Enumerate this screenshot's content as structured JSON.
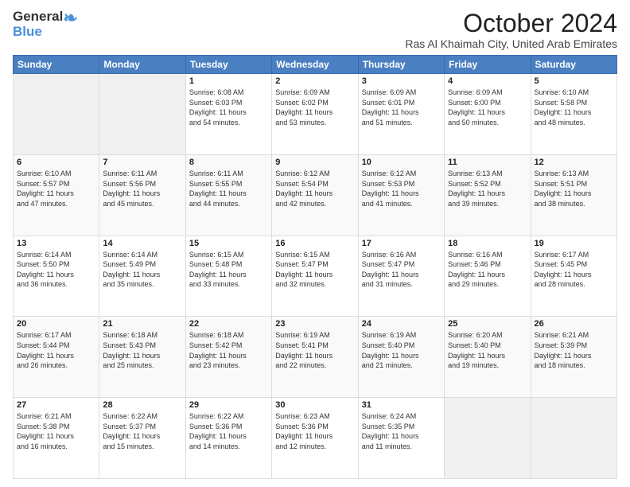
{
  "logo": {
    "line1": "General",
    "line2": "Blue"
  },
  "title": "October 2024",
  "location": "Ras Al Khaimah City, United Arab Emirates",
  "days_header": [
    "Sunday",
    "Monday",
    "Tuesday",
    "Wednesday",
    "Thursday",
    "Friday",
    "Saturday"
  ],
  "weeks": [
    [
      {
        "day": "",
        "info": ""
      },
      {
        "day": "",
        "info": ""
      },
      {
        "day": "1",
        "info": "Sunrise: 6:08 AM\nSunset: 6:03 PM\nDaylight: 11 hours\nand 54 minutes."
      },
      {
        "day": "2",
        "info": "Sunrise: 6:09 AM\nSunset: 6:02 PM\nDaylight: 11 hours\nand 53 minutes."
      },
      {
        "day": "3",
        "info": "Sunrise: 6:09 AM\nSunset: 6:01 PM\nDaylight: 11 hours\nand 51 minutes."
      },
      {
        "day": "4",
        "info": "Sunrise: 6:09 AM\nSunset: 6:00 PM\nDaylight: 11 hours\nand 50 minutes."
      },
      {
        "day": "5",
        "info": "Sunrise: 6:10 AM\nSunset: 5:58 PM\nDaylight: 11 hours\nand 48 minutes."
      }
    ],
    [
      {
        "day": "6",
        "info": "Sunrise: 6:10 AM\nSunset: 5:57 PM\nDaylight: 11 hours\nand 47 minutes."
      },
      {
        "day": "7",
        "info": "Sunrise: 6:11 AM\nSunset: 5:56 PM\nDaylight: 11 hours\nand 45 minutes."
      },
      {
        "day": "8",
        "info": "Sunrise: 6:11 AM\nSunset: 5:55 PM\nDaylight: 11 hours\nand 44 minutes."
      },
      {
        "day": "9",
        "info": "Sunrise: 6:12 AM\nSunset: 5:54 PM\nDaylight: 11 hours\nand 42 minutes."
      },
      {
        "day": "10",
        "info": "Sunrise: 6:12 AM\nSunset: 5:53 PM\nDaylight: 11 hours\nand 41 minutes."
      },
      {
        "day": "11",
        "info": "Sunrise: 6:13 AM\nSunset: 5:52 PM\nDaylight: 11 hours\nand 39 minutes."
      },
      {
        "day": "12",
        "info": "Sunrise: 6:13 AM\nSunset: 5:51 PM\nDaylight: 11 hours\nand 38 minutes."
      }
    ],
    [
      {
        "day": "13",
        "info": "Sunrise: 6:14 AM\nSunset: 5:50 PM\nDaylight: 11 hours\nand 36 minutes."
      },
      {
        "day": "14",
        "info": "Sunrise: 6:14 AM\nSunset: 5:49 PM\nDaylight: 11 hours\nand 35 minutes."
      },
      {
        "day": "15",
        "info": "Sunrise: 6:15 AM\nSunset: 5:48 PM\nDaylight: 11 hours\nand 33 minutes."
      },
      {
        "day": "16",
        "info": "Sunrise: 6:15 AM\nSunset: 5:47 PM\nDaylight: 11 hours\nand 32 minutes."
      },
      {
        "day": "17",
        "info": "Sunrise: 6:16 AM\nSunset: 5:47 PM\nDaylight: 11 hours\nand 31 minutes."
      },
      {
        "day": "18",
        "info": "Sunrise: 6:16 AM\nSunset: 5:46 PM\nDaylight: 11 hours\nand 29 minutes."
      },
      {
        "day": "19",
        "info": "Sunrise: 6:17 AM\nSunset: 5:45 PM\nDaylight: 11 hours\nand 28 minutes."
      }
    ],
    [
      {
        "day": "20",
        "info": "Sunrise: 6:17 AM\nSunset: 5:44 PM\nDaylight: 11 hours\nand 26 minutes."
      },
      {
        "day": "21",
        "info": "Sunrise: 6:18 AM\nSunset: 5:43 PM\nDaylight: 11 hours\nand 25 minutes."
      },
      {
        "day": "22",
        "info": "Sunrise: 6:18 AM\nSunset: 5:42 PM\nDaylight: 11 hours\nand 23 minutes."
      },
      {
        "day": "23",
        "info": "Sunrise: 6:19 AM\nSunset: 5:41 PM\nDaylight: 11 hours\nand 22 minutes."
      },
      {
        "day": "24",
        "info": "Sunrise: 6:19 AM\nSunset: 5:40 PM\nDaylight: 11 hours\nand 21 minutes."
      },
      {
        "day": "25",
        "info": "Sunrise: 6:20 AM\nSunset: 5:40 PM\nDaylight: 11 hours\nand 19 minutes."
      },
      {
        "day": "26",
        "info": "Sunrise: 6:21 AM\nSunset: 5:39 PM\nDaylight: 11 hours\nand 18 minutes."
      }
    ],
    [
      {
        "day": "27",
        "info": "Sunrise: 6:21 AM\nSunset: 5:38 PM\nDaylight: 11 hours\nand 16 minutes."
      },
      {
        "day": "28",
        "info": "Sunrise: 6:22 AM\nSunset: 5:37 PM\nDaylight: 11 hours\nand 15 minutes."
      },
      {
        "day": "29",
        "info": "Sunrise: 6:22 AM\nSunset: 5:36 PM\nDaylight: 11 hours\nand 14 minutes."
      },
      {
        "day": "30",
        "info": "Sunrise: 6:23 AM\nSunset: 5:36 PM\nDaylight: 11 hours\nand 12 minutes."
      },
      {
        "day": "31",
        "info": "Sunrise: 6:24 AM\nSunset: 5:35 PM\nDaylight: 11 hours\nand 11 minutes."
      },
      {
        "day": "",
        "info": ""
      },
      {
        "day": "",
        "info": ""
      }
    ]
  ]
}
